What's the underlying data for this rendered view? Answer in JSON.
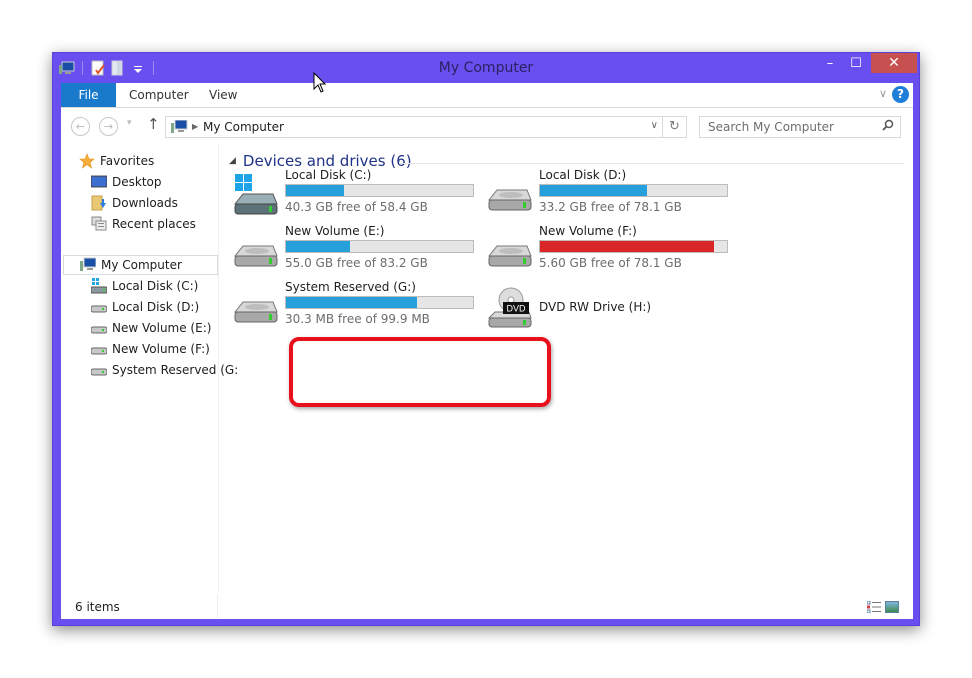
{
  "window": {
    "title": "My Computer",
    "controls": {
      "minimize": "–",
      "maximize": "☐",
      "close": "✕"
    },
    "quick_access": [
      "computer-icon",
      "properties-icon",
      "new-folder-icon",
      "customize-dropdown-icon"
    ]
  },
  "ribbon": {
    "tabs": [
      {
        "label": "File",
        "active": true
      },
      {
        "label": "Computer",
        "active": false
      },
      {
        "label": "View",
        "active": false
      }
    ],
    "expand": "∨",
    "help": "?"
  },
  "navigation": {
    "back": "←",
    "forward": "→",
    "recent": "▾",
    "up": "↑",
    "breadcrumb": [
      "My Computer"
    ],
    "address_dropdown": "∨",
    "refresh": "↻",
    "search_placeholder": "Search My Computer",
    "search_icon": "⚲"
  },
  "sidebar": {
    "favorites": {
      "label": "Favorites",
      "items": [
        {
          "label": "Desktop",
          "icon": "desktop-icon"
        },
        {
          "label": "Downloads",
          "icon": "downloads-icon"
        },
        {
          "label": "Recent places",
          "icon": "recent-places-icon"
        }
      ]
    },
    "computer": {
      "label": "My Computer",
      "selected": true,
      "items": [
        {
          "label": "Local Disk (C:)",
          "icon": "system-drive-icon"
        },
        {
          "label": "Local Disk (D:)",
          "icon": "drive-icon"
        },
        {
          "label": "New Volume (E:)",
          "icon": "drive-icon"
        },
        {
          "label": "New Volume (F:)",
          "icon": "drive-icon"
        },
        {
          "label": "System Reserved (G:",
          "icon": "drive-icon"
        }
      ]
    }
  },
  "main": {
    "group_title": "Devices and drives (6)",
    "group_collapse": "◢",
    "drives": [
      {
        "name": "Local Disk (C:)",
        "free": "40.3 GB free of 58.4 GB",
        "used_fraction": 0.31,
        "status": "normal",
        "type": "system"
      },
      {
        "name": "Local Disk (D:)",
        "free": "33.2 GB free of 78.1 GB",
        "used_fraction": 0.57,
        "status": "normal",
        "type": "disk"
      },
      {
        "name": "New Volume (E:)",
        "free": "55.0 GB free of 83.2 GB",
        "used_fraction": 0.34,
        "status": "normal",
        "type": "disk"
      },
      {
        "name": "New Volume (F:)",
        "free": "5.60 GB free of 78.1 GB",
        "used_fraction": 0.93,
        "status": "critical",
        "type": "disk"
      },
      {
        "name": "System Reserved (G:)",
        "free": "30.3 MB free of 99.9 MB",
        "used_fraction": 0.7,
        "status": "normal",
        "type": "disk",
        "highlighted": true
      },
      {
        "name": "DVD RW Drive (H:)",
        "type": "dvd",
        "dvd_label": "DVD"
      }
    ]
  },
  "status": {
    "items_count": "6 items"
  },
  "colors": {
    "window_frame": "#6a4ff0",
    "file_tab": "#1979ca",
    "bar_normal": "#26a0da",
    "bar_critical": "#da2626",
    "highlight": "#e8101a",
    "close_button": "#c75050"
  }
}
